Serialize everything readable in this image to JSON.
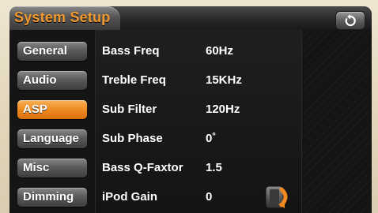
{
  "header": {
    "title": "System Setup",
    "back_icon": "back-arrow-icon"
  },
  "sidebar": {
    "items": [
      {
        "label": "General",
        "active": false
      },
      {
        "label": "Audio",
        "active": false
      },
      {
        "label": "ASP",
        "active": true
      },
      {
        "label": "Language",
        "active": false
      },
      {
        "label": "Misc",
        "active": false
      },
      {
        "label": "Dimming",
        "active": false
      }
    ]
  },
  "settings": {
    "rows": [
      {
        "label": "Bass Freq",
        "value": "60Hz"
      },
      {
        "label": "Treble Freq",
        "value": "15KHz"
      },
      {
        "label": "Sub Filter",
        "value": "120Hz"
      },
      {
        "label": "Sub Phase",
        "value": "0˚"
      },
      {
        "label": "Bass Q-Faxtor",
        "value": "1.5"
      },
      {
        "label": "iPod Gain",
        "value": "0"
      }
    ]
  },
  "knob": {
    "icon": "rotary-knob-icon"
  },
  "colors": {
    "accent": "#ef8b21",
    "title": "#f39a2e",
    "background": "#141414"
  }
}
